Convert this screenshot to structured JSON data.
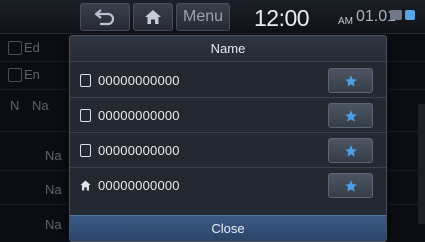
{
  "topbar": {
    "menu_label": "Menu",
    "time": "12:00",
    "ampm": "AM",
    "date": "01.01"
  },
  "background_list": [
    {
      "text": "Ed"
    },
    {
      "text": "En"
    },
    {
      "prefix": "N",
      "text": "Na"
    },
    {
      "text": "Na"
    },
    {
      "text": "Na"
    },
    {
      "text": "Na"
    }
  ],
  "popup": {
    "title": "Name",
    "numbers": [
      {
        "number": "00000000000",
        "type": "mobile"
      },
      {
        "number": "00000000000",
        "type": "mobile"
      },
      {
        "number": "00000000000",
        "type": "mobile"
      },
      {
        "number": "00000000000",
        "type": "home"
      }
    ],
    "close_label": "Close"
  },
  "colors": {
    "favorite_star": "#4a9fe8",
    "close_button": "#34507a"
  }
}
